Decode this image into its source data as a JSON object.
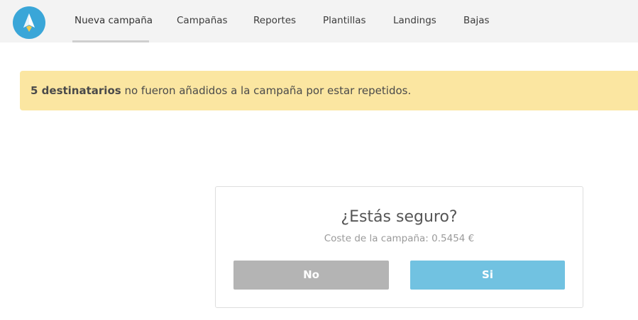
{
  "colors": {
    "topbar_bg": "#f3f3f3",
    "logo_bg": "#3aa6d8",
    "alert_bg": "#fbe6a1",
    "btn_no_bg": "#b4b4b4",
    "btn_si_bg": "#71c2e1"
  },
  "logo": {
    "icon": "paper-rocket-icon"
  },
  "nav": {
    "items": [
      {
        "label": "Nueva campaña",
        "active": true
      },
      {
        "label": "Campañas"
      },
      {
        "label": "Reportes"
      },
      {
        "label": "Plantillas"
      },
      {
        "label": "Landings"
      },
      {
        "label": "Bajas"
      }
    ]
  },
  "alert": {
    "count_text": "5 destinatarios",
    "message": " no fueron añadidos a la campaña por estar repetidos."
  },
  "modal": {
    "title": "¿Estás seguro?",
    "subtitle": "Coste de la campaña: 0.5454 €",
    "no_label": "No",
    "si_label": "Si"
  }
}
